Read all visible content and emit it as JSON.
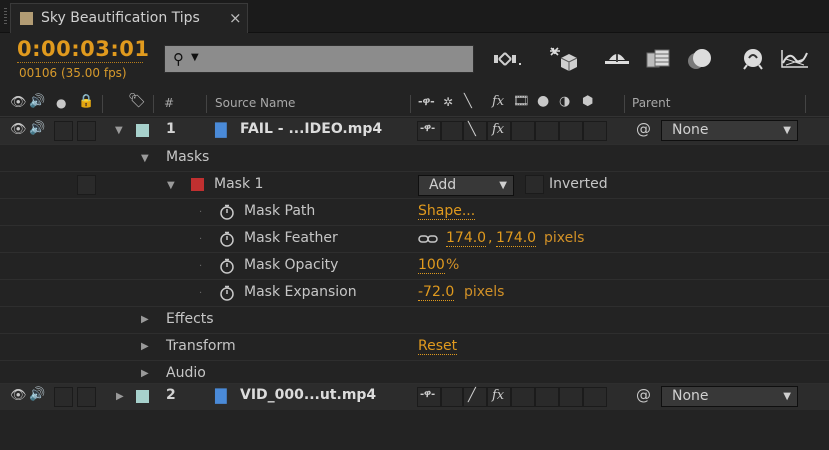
{
  "panel": {
    "tab_title": "Sky Beautification Tips",
    "close_glyph": "×",
    "tab_swatch_color": "#b29c74"
  },
  "header": {
    "timecode": "0:00:03:01",
    "frames": "00106 (35.00 fps)",
    "search_placeholder": "",
    "search_icon": "search-icon"
  },
  "toolbar_icons": [
    "composition-mini-flowchart-icon",
    "draft-3d-icon",
    "shy-layers-icon",
    "frame-blending-icon",
    "motion-blur-icon",
    "brainstorm-icon",
    "graph-editor-icon"
  ],
  "columns": {
    "number": "#",
    "source_name": "Source Name",
    "parent": "Parent"
  },
  "layers": [
    {
      "number": "1",
      "name": "FAIL - ...IDEO.mp4",
      "label_color": "#a7d1cc",
      "parent": "None"
    },
    {
      "number": "2",
      "name": "VID_000...ut.mp4",
      "label_color": "#a7d1cc",
      "parent": "None"
    }
  ],
  "groups": {
    "masks": "Masks",
    "effects": "Effects",
    "transform": "Transform",
    "audio": "Audio"
  },
  "mask": {
    "name": "Mask 1",
    "color": "#c03030",
    "mode": "Add",
    "inverted_label": "Inverted",
    "properties": {
      "path_label": "Mask Path",
      "path_value": "Shape...",
      "feather_label": "Mask Feather",
      "feather_x": "174.0",
      "feather_sep": ",",
      "feather_y": "174.0",
      "feather_unit": "pixels",
      "opacity_label": "Mask Opacity",
      "opacity_value": "100",
      "opacity_unit": "%",
      "expansion_label": "Mask Expansion",
      "expansion_value": "-72.0",
      "expansion_unit": "pixels"
    }
  },
  "transform_reset": "Reset",
  "colors": {
    "accent": "#e09a1e",
    "panel_bg": "#232323",
    "search_bg": "#8c8c8c"
  }
}
